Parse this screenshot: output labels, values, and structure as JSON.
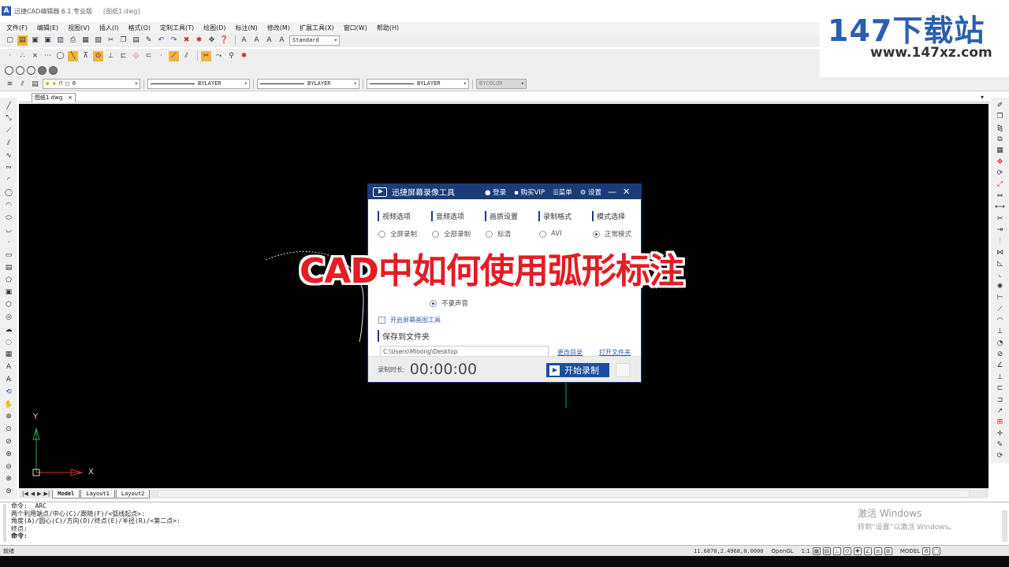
{
  "window": {
    "title": "迅捷CAD编辑器 6.1 专业版",
    "document": "[图纸1.dwg]"
  },
  "menu": [
    "文件(F)",
    "编辑(E)",
    "视图(V)",
    "插入(I)",
    "格式(O)",
    "定制工具(T)",
    "绘图(D)",
    "标注(N)",
    "修改(M)",
    "扩展工具(X)",
    "窗口(W)",
    "帮助(H)"
  ],
  "toolbar": {
    "text_style": "Standard",
    "layer": "0",
    "linetype1": "BYLAYER",
    "linetype2": "BYLAYER",
    "lineweight": "BYLAYER",
    "plotstyle": "BYCOLOR"
  },
  "watermark": {
    "brand_num": "147",
    "brand_cn": "下载站",
    "url": "www.147xz.com"
  },
  "doc_tab": {
    "name": "图纸1.dwg",
    "close": "×"
  },
  "layout_tabs": [
    "Model",
    "Layout1",
    "Layout2"
  ],
  "canvas": {
    "axis_x": "X",
    "axis_y": "Y"
  },
  "recorder": {
    "title": "迅捷屏幕录像工具",
    "header_buttons": [
      "登录",
      "购买VIP",
      "菜单",
      "设置"
    ],
    "sections": [
      "视频选项",
      "音频选项",
      "画质设置",
      "录制格式",
      "模式选择"
    ],
    "options": [
      "全屏录制",
      "全部录制",
      "标清",
      "AVI",
      "正常模式"
    ],
    "selected": {
      "video": false,
      "audio": false,
      "quality": false,
      "format": false,
      "mode": true
    },
    "no_audio": "不录声音",
    "toolbar_check": "开启屏幕画图工具",
    "save_label": "保存到文件夹",
    "path": "C:\\Users\\Mloong\\Desktop",
    "change_dir": "更改目录",
    "open_dir": "打开文件夹",
    "time_label": "录制时长:",
    "time": "00:00:00",
    "start": "开始录制"
  },
  "caption": "CAD中如何使用弧形标注",
  "command": {
    "lines": [
      "命令:  _ARC",
      "两个利用端点/中心(C)/跟随(F)/<弧线起点>:",
      "角度(A)/圆心(C)/方向(D)/终点(E)/半径(R)/<第二点>:",
      "终点:",
      "命令:"
    ]
  },
  "activation": {
    "line1": "激活 Windows",
    "line2": "转到“设置”以激活 Windows。"
  },
  "status": {
    "left": "就绪",
    "coords": "11.6870,2.4968,0.0000",
    "renderer": "OpenGL",
    "scale": "1:1",
    "space": "MODEL"
  }
}
